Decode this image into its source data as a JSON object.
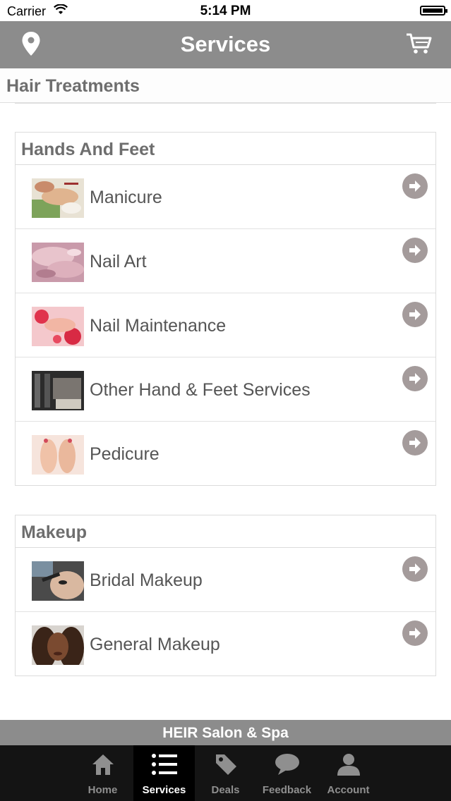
{
  "status_bar": {
    "carrier": "Carrier",
    "time": "5:14 PM"
  },
  "navbar": {
    "title": "Services"
  },
  "hair_section": {
    "title": "Hair Treatments"
  },
  "sections": [
    {
      "title": "Hands And Feet",
      "items": [
        {
          "label": "Manicure"
        },
        {
          "label": "Nail Art"
        },
        {
          "label": "Nail Maintenance"
        },
        {
          "label": "Other Hand & Feet Services"
        },
        {
          "label": "Pedicure"
        }
      ]
    },
    {
      "title": "Makeup",
      "items": [
        {
          "label": "Bridal Makeup"
        },
        {
          "label": "General Makeup"
        }
      ]
    }
  ],
  "brand_bar": {
    "text": "HEIR Salon & Spa"
  },
  "tabbar": {
    "tabs": [
      {
        "label": "Home",
        "icon": "home-icon"
      },
      {
        "label": "Services",
        "icon": "list-icon",
        "active": true
      },
      {
        "label": "Deals",
        "icon": "tag-icon"
      },
      {
        "label": "Feedback",
        "icon": "chat-bubble-icon"
      },
      {
        "label": "Account",
        "icon": "user-icon"
      }
    ]
  },
  "colors": {
    "nav_gray": "#8c8c8c",
    "arrow": "#a49b9b",
    "tabbar": "#141414"
  }
}
